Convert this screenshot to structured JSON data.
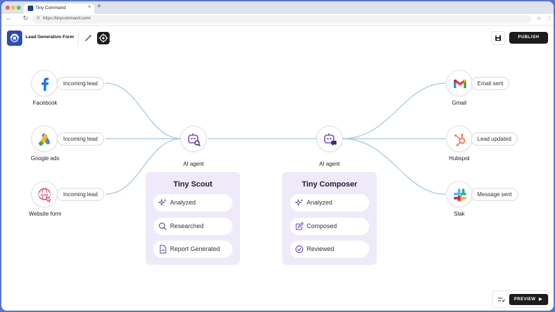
{
  "browser": {
    "tab_title": "Tiny Command",
    "url": "https://tinycommand.com/"
  },
  "header": {
    "form_title": "Lead Generation Form",
    "publish_label": "PUBLISH",
    "preview_label": "PREVIEW"
  },
  "sources": [
    {
      "name": "Facebook",
      "pill": "Incoming lead",
      "icon": "facebook-icon"
    },
    {
      "name": "Google ads",
      "pill": "Incoming lead",
      "icon": "google-ads-icon"
    },
    {
      "name": "Website form",
      "pill": "Incoming lead",
      "icon": "website-form-icon"
    }
  ],
  "destinations": [
    {
      "name": "Gmail",
      "pill": "Email sent",
      "icon": "gmail-icon"
    },
    {
      "name": "Hubspot",
      "pill": "Lead updated",
      "icon": "hubspot-icon"
    },
    {
      "name": "Slak",
      "pill": "Message  sent",
      "icon": "slack-icon"
    }
  ],
  "agents": [
    {
      "label": "AI agent",
      "card_title": "Tiny Scout",
      "steps": [
        {
          "label": "Analyzed",
          "icon": "sparkle-icon"
        },
        {
          "label": "Researched",
          "icon": "search-icon"
        },
        {
          "label": "Report Generated",
          "icon": "document-icon"
        }
      ]
    },
    {
      "label": "AI agent",
      "card_title": "Tiny Composer",
      "steps": [
        {
          "label": "Analyzed",
          "icon": "sparkle-icon"
        },
        {
          "label": "Composed",
          "icon": "edit-icon"
        },
        {
          "label": "Reviewed",
          "icon": "check-circle-icon"
        }
      ]
    }
  ],
  "colors": {
    "accent_purple": "#7a4bd0",
    "card_bg": "#efeaf9",
    "connector": "#9ec9ea",
    "dark_button": "#1c1c1c",
    "brand_blue": "#2b4cb0"
  }
}
